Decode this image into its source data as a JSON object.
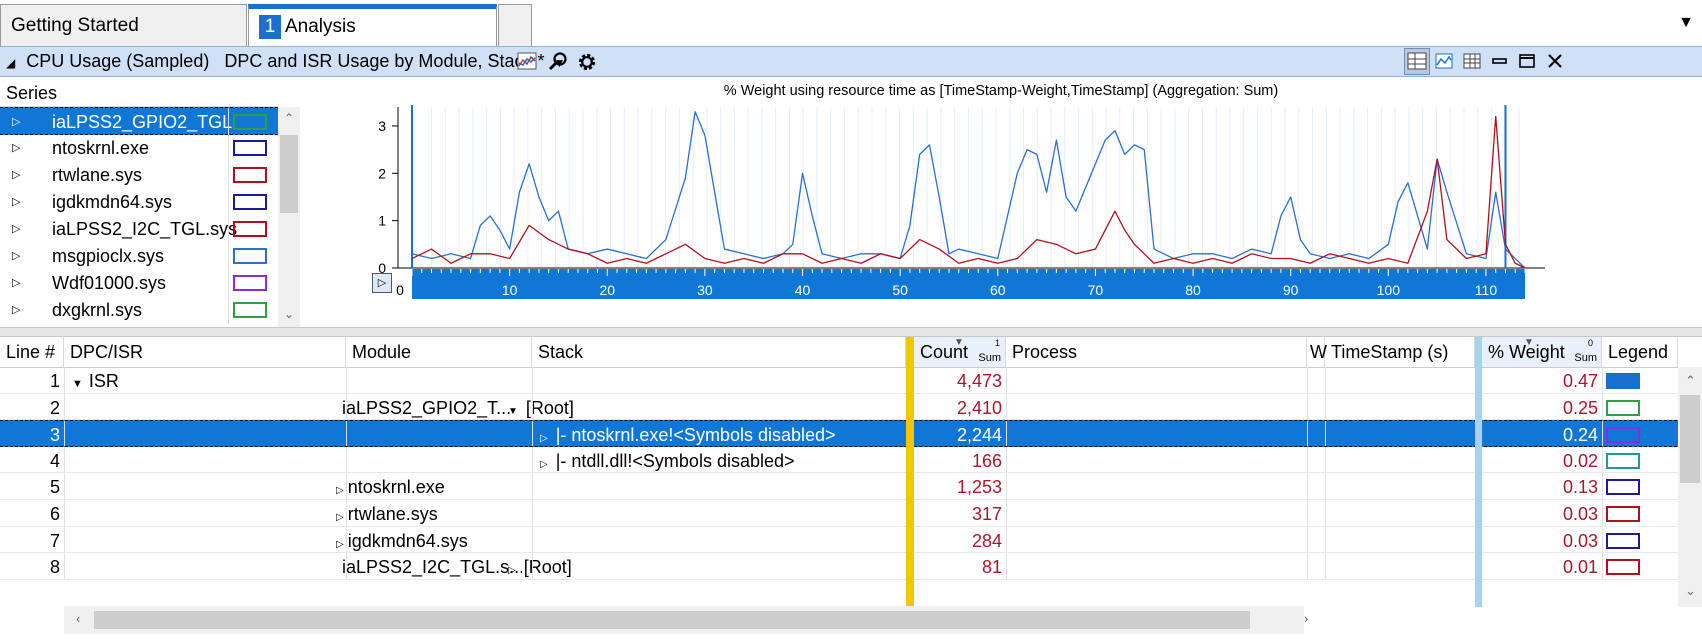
{
  "tabs": [
    {
      "label": "Getting Started"
    },
    {
      "number": "1",
      "label": "Analysis"
    }
  ],
  "graph": {
    "title": "CPU Usage (Sampled)",
    "preset": "DPC and ISR Usage by Module, Stack *",
    "chart_title": "% Weight using resource time as [TimeStamp-Weight,TimeStamp] (Aggregation: Sum)"
  },
  "series": {
    "header": "Series",
    "items": [
      {
        "label": "iaLPSS2_GPIO2_TGL....",
        "color": "#2ea043"
      },
      {
        "label": "ntoskrnl.exe",
        "color": "#1a1a9a"
      },
      {
        "label": "rtwlane.sys",
        "color": "#b0101e"
      },
      {
        "label": "igdkmdn64.sys",
        "color": "#1a1a9a"
      },
      {
        "label": "iaLPSS2_I2C_TGL.sys",
        "color": "#b0101e"
      },
      {
        "label": "msgpioclx.sys",
        "color": "#2a6fcf"
      },
      {
        "label": "Wdf01000.sys",
        "color": "#8a2be2"
      },
      {
        "label": "dxgkrnl.sys",
        "color": "#2ea043"
      }
    ]
  },
  "chart_data": {
    "type": "line",
    "title": "% Weight using resource time as [TimeStamp-Weight,TimeStamp] (Aggregation: Sum)",
    "ylim": [
      0,
      3.4
    ],
    "yticks": [
      "0",
      "1",
      "2",
      "3"
    ],
    "xlim": [
      0,
      114
    ],
    "xticks": [
      "0",
      "10",
      "20",
      "30",
      "40",
      "50",
      "60",
      "70",
      "80",
      "90",
      "100",
      "110"
    ],
    "series": [
      {
        "color": "#2a6fcf",
        "x": [
          0,
          2,
          4,
          6,
          7,
          8,
          9,
          10,
          11,
          12,
          13,
          14,
          15,
          16,
          18,
          20,
          22,
          24,
          26,
          28,
          29,
          30,
          31,
          32,
          34,
          36,
          38,
          39,
          40,
          41,
          42,
          44,
          46,
          48,
          50,
          51,
          52,
          53,
          54,
          55,
          56,
          58,
          60,
          61,
          62,
          63,
          64,
          65,
          66,
          67,
          68,
          70,
          71,
          72,
          73,
          74,
          75,
          76,
          77,
          78,
          80,
          82,
          84,
          86,
          88,
          89,
          90,
          91,
          92,
          94,
          96,
          98,
          100,
          101,
          102,
          104,
          105,
          106,
          108,
          110,
          111,
          112,
          113,
          114
        ],
        "y": [
          0.3,
          0.2,
          0.3,
          0.2,
          0.9,
          1.1,
          0.8,
          0.4,
          1.6,
          2.2,
          1.5,
          1.0,
          1.2,
          0.4,
          0.3,
          0.4,
          0.3,
          0.2,
          0.6,
          1.9,
          3.3,
          2.8,
          1.6,
          0.4,
          0.3,
          0.2,
          0.3,
          0.5,
          2.0,
          1.1,
          0.3,
          0.2,
          0.3,
          0.3,
          0.2,
          0.9,
          2.4,
          2.6,
          1.5,
          0.3,
          0.4,
          0.3,
          0.2,
          1.1,
          2.0,
          2.5,
          2.4,
          1.6,
          2.7,
          1.5,
          1.2,
          2.2,
          2.7,
          2.9,
          2.4,
          2.6,
          2.5,
          0.4,
          0.3,
          0.2,
          0.3,
          0.3,
          0.2,
          0.4,
          0.3,
          1.1,
          1.5,
          0.6,
          0.3,
          0.2,
          0.3,
          0.2,
          0.5,
          1.4,
          1.8,
          0.4,
          2.3,
          1.6,
          0.3,
          0.2,
          1.6,
          0.4,
          0.2,
          0.0
        ]
      },
      {
        "color": "#b0101e",
        "x": [
          0,
          2,
          4,
          6,
          8,
          10,
          12,
          14,
          16,
          18,
          20,
          22,
          24,
          26,
          28,
          30,
          32,
          34,
          36,
          38,
          40,
          42,
          44,
          46,
          48,
          50,
          52,
          54,
          56,
          58,
          60,
          62,
          64,
          66,
          68,
          70,
          72,
          73,
          74,
          76,
          78,
          80,
          82,
          84,
          86,
          88,
          90,
          92,
          94,
          96,
          98,
          100,
          102,
          104,
          105,
          106,
          108,
          110,
          111,
          112,
          113,
          114
        ],
        "y": [
          0.2,
          0.4,
          0.1,
          0.3,
          0.3,
          0.2,
          0.9,
          0.6,
          0.4,
          0.3,
          0.1,
          0.2,
          0.1,
          0.3,
          0.5,
          0.2,
          0.1,
          0.2,
          0.1,
          0.3,
          0.3,
          0.1,
          0.2,
          0.1,
          0.3,
          0.2,
          0.6,
          0.4,
          0.1,
          0.2,
          0.1,
          0.2,
          0.6,
          0.5,
          0.3,
          0.4,
          1.2,
          0.8,
          0.5,
          0.1,
          0.2,
          0.1,
          0.2,
          0.1,
          0.3,
          0.2,
          0.2,
          0.1,
          0.3,
          0.2,
          0.1,
          0.2,
          0.1,
          1.2,
          2.3,
          0.6,
          0.2,
          0.3,
          3.2,
          0.5,
          0.1,
          0.0
        ]
      }
    ]
  },
  "table": {
    "columns": [
      "Line #",
      "DPC/ISR",
      "Module",
      "Stack",
      "Count",
      "Process",
      "W",
      "TimeStamp (s)",
      "% Weight",
      "Legend"
    ],
    "count_sort": "1",
    "count_agg": "Sum",
    "weight_sort": "0",
    "weight_agg": "Sum",
    "rows": [
      {
        "line": "1",
        "dpc": "ISR",
        "module": "",
        "stack": "",
        "count": "4,473",
        "weight": "0.47",
        "legend": "#1a6fcf",
        "fill": true
      },
      {
        "line": "2",
        "dpc": "",
        "module": "iaLPSS2_GPIO2_T...",
        "stack": "[Root]",
        "count": "2,410",
        "weight": "0.25",
        "legend": "#2ea043"
      },
      {
        "line": "3",
        "dpc": "",
        "module": "",
        "stack": "|- ntoskrnl.exe!<Symbols disabled>",
        "count": "2,244",
        "weight": "0.24",
        "legend": "#8a2be2"
      },
      {
        "line": "4",
        "dpc": "",
        "module": "",
        "stack": "|- ntdll.dll!<Symbols disabled>",
        "count": "166",
        "weight": "0.02",
        "legend": "#1a9a9a"
      },
      {
        "line": "5",
        "dpc": "",
        "module": "ntoskrnl.exe",
        "stack": "",
        "count": "1,253",
        "weight": "0.13",
        "legend": "#1a1a9a"
      },
      {
        "line": "6",
        "dpc": "",
        "module": "rtwlane.sys",
        "stack": "",
        "count": "317",
        "weight": "0.03",
        "legend": "#b0101e"
      },
      {
        "line": "7",
        "dpc": "",
        "module": "igdkmdn64.sys",
        "stack": "",
        "count": "284",
        "weight": "0.03",
        "legend": "#1a1a9a"
      },
      {
        "line": "8",
        "dpc": "",
        "module": "iaLPSS2_I2C_TGL.s...",
        "stack": "[Root]",
        "count": "81",
        "weight": "0.01",
        "legend": "#b0101e"
      }
    ]
  }
}
